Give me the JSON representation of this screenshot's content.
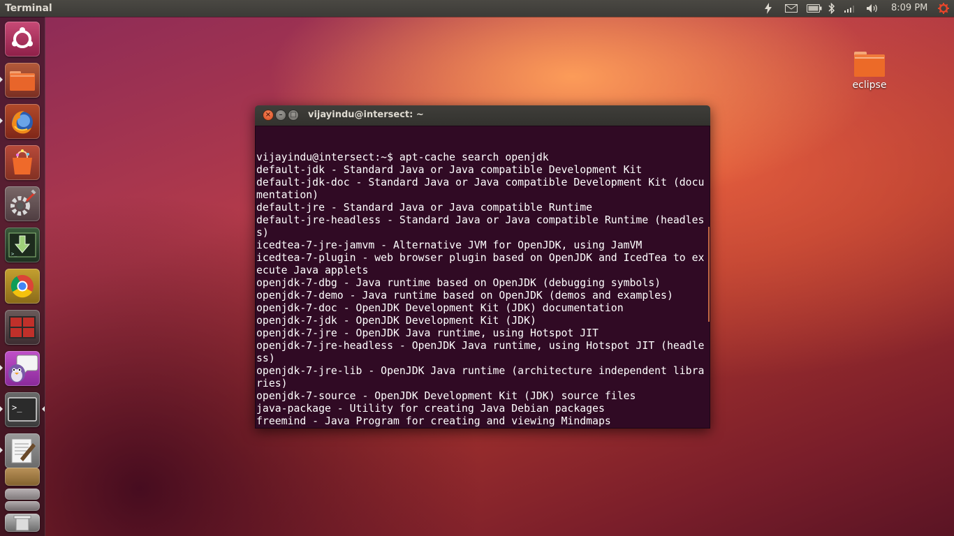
{
  "top_panel": {
    "app_title": "Terminal",
    "clock": "8:09 PM",
    "indicators": [
      "power-icon",
      "mail-icon",
      "battery-icon",
      "bluetooth-icon",
      "network-icon",
      "volume-icon",
      "session-gear-icon"
    ]
  },
  "launcher": {
    "items": [
      {
        "name": "dash-home-icon"
      },
      {
        "name": "files-icon"
      },
      {
        "name": "firefox-icon"
      },
      {
        "name": "software-center-icon"
      },
      {
        "name": "system-settings-icon"
      },
      {
        "name": "update-manager-icon"
      },
      {
        "name": "chrome-icon"
      },
      {
        "name": "workspace-switcher-icon"
      },
      {
        "name": "pidgin-icon"
      },
      {
        "name": "terminal-icon"
      },
      {
        "name": "text-editor-icon"
      },
      {
        "name": "trash-icon"
      }
    ]
  },
  "desktop": {
    "icons": [
      {
        "label": "eclipse",
        "icon": "folder-icon"
      }
    ]
  },
  "terminal": {
    "window_title": "vijayindu@intersect: ~",
    "lines": [
      "vijayindu@intersect:~$ apt-cache search openjdk",
      "default-jdk - Standard Java or Java compatible Development Kit",
      "default-jdk-doc - Standard Java or Java compatible Development Kit (docu",
      "mentation)",
      "default-jre - Standard Java or Java compatible Runtime",
      "default-jre-headless - Standard Java or Java compatible Runtime (headles",
      "s)",
      "icedtea-7-jre-jamvm - Alternative JVM for OpenJDK, using JamVM",
      "icedtea-7-plugin - web browser plugin based on OpenJDK and IcedTea to ex",
      "ecute Java applets",
      "openjdk-7-dbg - Java runtime based on OpenJDK (debugging symbols)",
      "openjdk-7-demo - Java runtime based on OpenJDK (demos and examples)",
      "openjdk-7-doc - OpenJDK Development Kit (JDK) documentation",
      "openjdk-7-jdk - OpenJDK Development Kit (JDK)",
      "openjdk-7-jre - OpenJDK Java runtime, using Hotspot JIT",
      "openjdk-7-jre-headless - OpenJDK Java runtime, using Hotspot JIT (headle",
      "ss)",
      "openjdk-7-jre-lib - OpenJDK Java runtime (architecture independent libra",
      "ries)",
      "openjdk-7-source - OpenJDK Development Kit (JDK) source files",
      "java-package - Utility for creating Java Debian packages",
      "freemind - Java Program for creating and viewing Mindmaps"
    ]
  },
  "colors": {
    "terminal_bg": "#300a24",
    "panel_bg": "#3c3b37",
    "close_button": "#e5582e",
    "accent": "#dd4814"
  }
}
